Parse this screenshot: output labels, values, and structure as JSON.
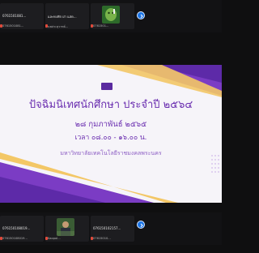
{
  "top_tiles": [
    {
      "title": "0761501081...",
      "name": "0761501081...",
      "type": "text"
    },
    {
      "title": "และทงฟัก ฝา แสด...",
      "name": "นพประสุวาทธ์...",
      "type": "text"
    },
    {
      "title": "",
      "name": "0761501...",
      "type": "avatar"
    }
  ],
  "bottom_tiles": [
    {
      "title": "076150108019...",
      "name": "076150108019...",
      "type": "text"
    },
    {
      "title": "",
      "name": "Kaopol...",
      "type": "avatar"
    },
    {
      "title": "076150102157...",
      "name": "07615010...",
      "type": "text"
    }
  ],
  "slide": {
    "title": "ปัจฉิมนิเทศนักศึกษา ประจำปี ๒๕๖๔",
    "date": "๒๘ กุมภาพันธ์ ๒๕๖๕",
    "time": "เวลา ๐๘.๐๐ - ๑๖.๐๐ น.",
    "university": "มหาวิทยาลัยเทคโนโลยีราชมงคลพระนคร",
    "colors": {
      "purple": "#6b2fb0",
      "gold": "#f3c766"
    }
  },
  "nav": {
    "next_icon": "chevron-right-icon"
  }
}
